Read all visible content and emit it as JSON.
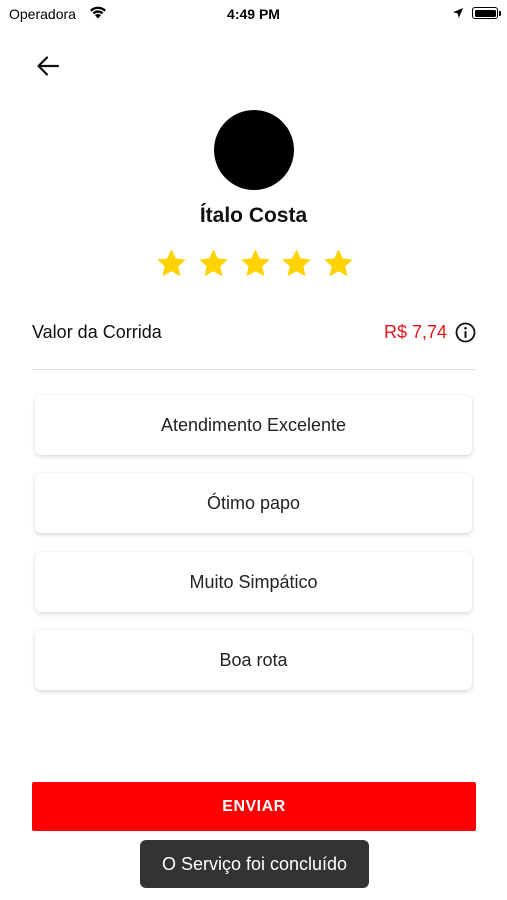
{
  "status_bar": {
    "carrier": "Operadora",
    "time": "4:49 PM"
  },
  "driver": {
    "name": "Ítalo Costa",
    "rating": 5,
    "rating_max": 5
  },
  "fare": {
    "label": "Valor da Corrida",
    "value": "R$ 7,74"
  },
  "options": [
    {
      "label": "Atendimento Excelente"
    },
    {
      "label": "Ótimo papo"
    },
    {
      "label": "Muito Simpático"
    },
    {
      "label": "Boa rota"
    }
  ],
  "send_button": {
    "label": "ENVIAR"
  },
  "toast": {
    "message": "O Serviço foi concluído"
  },
  "colors": {
    "accent": "#ff0000",
    "price": "#e8141b",
    "star": "#ffd200",
    "toast_bg": "#333333"
  },
  "icons": {
    "back": "arrow-left-icon",
    "info": "info-icon",
    "star": "star-icon",
    "wifi": "wifi-icon",
    "location": "location-arrow-icon",
    "battery": "battery-icon"
  }
}
